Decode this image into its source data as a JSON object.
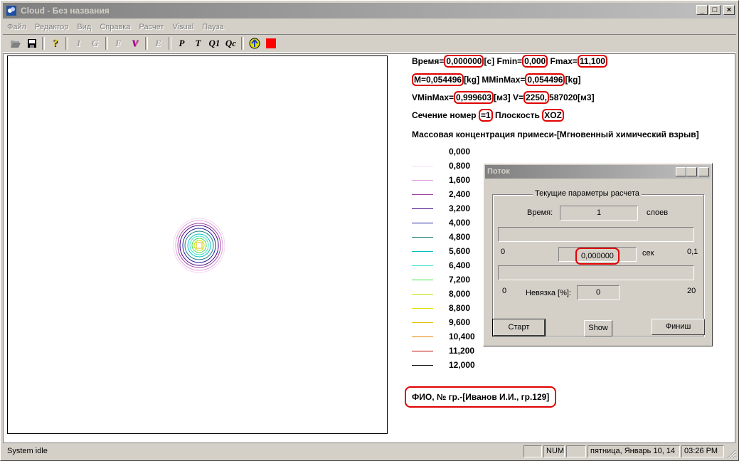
{
  "window": {
    "title": "Cloud - Без названия",
    "caption_buttons": {
      "minimize": "_",
      "maximize": "□",
      "close": "×"
    }
  },
  "menu": [
    "Файл",
    "Редактор",
    "Вид",
    "Справка",
    "Расчет",
    "Visual",
    "Пауза"
  ],
  "toolbar": {
    "items": [
      {
        "name": "open-icon",
        "label": ""
      },
      {
        "name": "save-icon",
        "label": ""
      },
      {
        "name": "help-icon",
        "label": "?"
      },
      {
        "name": "i-icon",
        "label": "I"
      },
      {
        "name": "g-icon",
        "label": "G"
      },
      {
        "name": "f-icon",
        "label": "F"
      },
      {
        "name": "v-icon",
        "label": "V"
      },
      {
        "name": "e-icon",
        "label": "E"
      },
      {
        "name": "p-icon",
        "label": "P"
      },
      {
        "name": "t-icon",
        "label": "T"
      },
      {
        "name": "q1-icon",
        "label": "Q1"
      },
      {
        "name": "qc-icon",
        "label": "Qc"
      },
      {
        "name": "run-icon",
        "label": ""
      },
      {
        "name": "stop-icon",
        "label": ""
      }
    ]
  },
  "info": {
    "time_label": "Время=",
    "time_value": "0,000000",
    "time_unit": "[c]",
    "fmin_label": "Fmin=",
    "fmin_value": "0,000",
    "fmax_label": "Fmax=",
    "fmax_value": "11,100",
    "m_value": "M=0,054496",
    "m_unit": "[kg]",
    "mminmax_label": "MMinMax=",
    "mminmax_value": "0,054496",
    "mminmax_unit": "[kg]",
    "vminmax_label": "VMinMax=",
    "vminmax_value": "0,999603",
    "vminmax_unit": "[м3]",
    "v_label": "V=",
    "v_value": "2250,",
    "v_rest": "587020[м3]",
    "section_label": "Сечение номер ",
    "section_value": "=1",
    "plane_label": "Плоскость ",
    "plane_value": "XOZ",
    "concentration_title": "Массовая концентрация примеси-[Мгновенный химический взрыв]",
    "fio": "ФИО, № гр.-[Иванов И.И., гр.129]"
  },
  "legend": [
    {
      "value": "0,000",
      "color": ""
    },
    {
      "value": "0,800",
      "color": "#f0e0f0"
    },
    {
      "value": "1,600",
      "color": "#e0a0e0"
    },
    {
      "value": "2,400",
      "color": "#a040a0"
    },
    {
      "value": "3,200",
      "color": "#400080"
    },
    {
      "value": "4,000",
      "color": "#2020a0"
    },
    {
      "value": "4,800",
      "color": "#208080"
    },
    {
      "value": "5,600",
      "color": "#00c0c0"
    },
    {
      "value": "6,400",
      "color": "#40e0d0"
    },
    {
      "value": "7,200",
      "color": "#40e040"
    },
    {
      "value": "8,000",
      "color": "#c0e000"
    },
    {
      "value": "8,800",
      "color": "#e0e000"
    },
    {
      "value": "9,600",
      "color": "#e0c000"
    },
    {
      "value": "10,400",
      "color": "#e08000"
    },
    {
      "value": "11,200",
      "color": "#c00000"
    },
    {
      "value": "12,000",
      "color": "#000000"
    }
  ],
  "dialog": {
    "title": "Поток",
    "group_title": "Текущие параметры расчета",
    "time_label": "Время:",
    "time_value": "1",
    "layers_label": "слоев",
    "min_left": "0",
    "seconds_value": "0,000000",
    "seconds_label": "сек",
    "max_right": "0,1",
    "residual_min": "0",
    "residual_label": "Невязка [%]:",
    "residual_value": "0",
    "residual_max": "20",
    "start_button": "Старт",
    "show_button": "Show",
    "finish_button": "Финиш"
  },
  "statusbar": {
    "status": "System idle",
    "num": "NUM",
    "date": "пятница, Январь 10, 14",
    "time": "03:26  PM"
  }
}
